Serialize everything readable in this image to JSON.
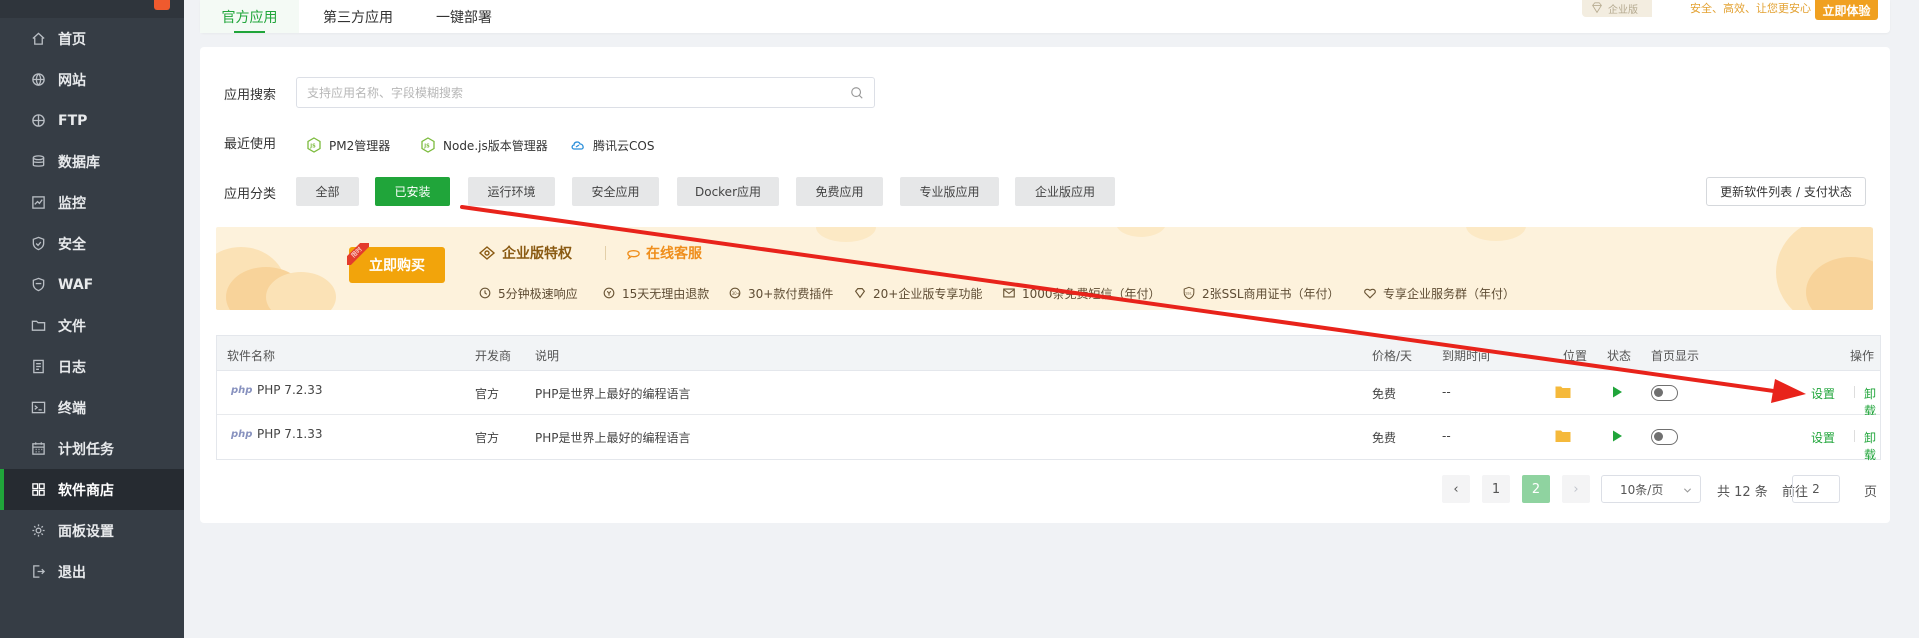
{
  "sidebar": {
    "items": [
      {
        "label": "首页",
        "icon": "home-icon"
      },
      {
        "label": "网站",
        "icon": "globe-icon"
      },
      {
        "label": "FTP",
        "icon": "ftp-icon"
      },
      {
        "label": "数据库",
        "icon": "database-icon"
      },
      {
        "label": "监控",
        "icon": "monitor-icon"
      },
      {
        "label": "安全",
        "icon": "shield-icon"
      },
      {
        "label": "WAF",
        "icon": "waf-shield-icon"
      },
      {
        "label": "文件",
        "icon": "folder-icon"
      },
      {
        "label": "日志",
        "icon": "log-icon"
      },
      {
        "label": "终端",
        "icon": "terminal-icon"
      },
      {
        "label": "计划任务",
        "icon": "calendar-icon"
      },
      {
        "label": "软件商店",
        "icon": "grid-icon",
        "active": true
      },
      {
        "label": "面板设置",
        "icon": "gear-icon"
      },
      {
        "label": "退出",
        "icon": "logout-icon"
      }
    ]
  },
  "tabs": {
    "official": "官方应用",
    "third_party": "第三方应用",
    "one_click": "一键部署"
  },
  "enterprise": {
    "chip": "企业版",
    "slogan": "安全、高效、让您更安心",
    "try_button": "立即体验"
  },
  "search": {
    "label": "应用搜索",
    "placeholder": "支持应用名称、字段模糊搜索"
  },
  "recent": {
    "label": "最近使用",
    "items": [
      "PM2管理器",
      "Node.js版本管理器",
      "腾讯云COS"
    ]
  },
  "categories": {
    "label": "应用分类",
    "items": [
      "全部",
      "已安装",
      "运行环境",
      "安全应用",
      "Docker应用",
      "免费应用",
      "专业版应用",
      "企业版应用"
    ],
    "active": "已安装",
    "update_button": "更新软件列表 / 支付状态"
  },
  "banner": {
    "buy_button": "立即购买",
    "buy_tag": "限时",
    "privilege": "企业版特权",
    "service": "在线客服",
    "perks": [
      "5分钟极速响应",
      "15天无理由退款",
      "30+款付费插件",
      "20+企业版专享功能",
      "1000条免费短信（年付）",
      "2张SSL商用证书（年付）",
      "专享企业服务群（年付）"
    ]
  },
  "table": {
    "headers": {
      "name": "软件名称",
      "vendor": "开发商",
      "desc": "说明",
      "price": "价格/天",
      "expire": "到期时间",
      "location": "位置",
      "status": "状态",
      "homepage": "首页显示",
      "ops": "操作"
    },
    "php_logo": "php",
    "rows": [
      {
        "name": "PHP 7.2.33",
        "vendor": "官方",
        "desc": "PHP是世界上最好的编程语言",
        "price": "免费",
        "expire": "--",
        "setting": "设置",
        "uninstall": "卸载"
      },
      {
        "name": "PHP 7.1.33",
        "vendor": "官方",
        "desc": "PHP是世界上最好的编程语言",
        "price": "免费",
        "expire": "--",
        "setting": "设置",
        "uninstall": "卸载"
      }
    ]
  },
  "pagination": {
    "prev": "‹",
    "pages": [
      "1",
      "2"
    ],
    "current": "2",
    "next": "›",
    "page_size": "10条/页",
    "total": "共 12 条",
    "goto_label": "前往",
    "goto_value": "2",
    "goto_suffix": "页"
  },
  "colors": {
    "accent": "#20a53a",
    "sidebar": "#363d45",
    "annotation_arrow": "#e8231b"
  }
}
